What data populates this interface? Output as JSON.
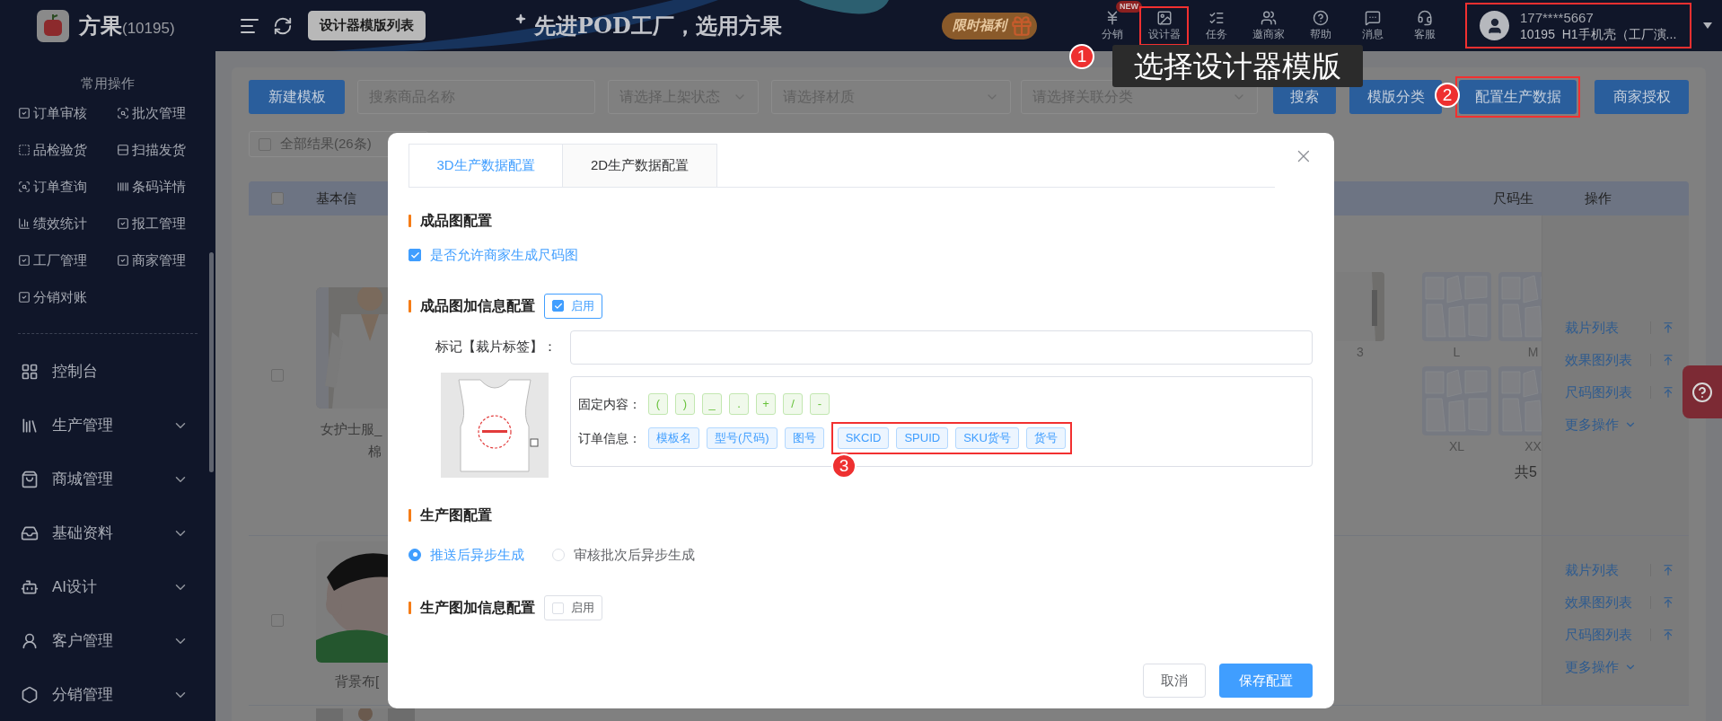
{
  "header": {
    "brand": "方果",
    "brand_id": "(10195)",
    "page_tab": "设计器模版列表",
    "slogan": "先进POD工厂，选用方果",
    "promo": "限时福利",
    "nav": [
      {
        "label": "分销",
        "badge": "NEW",
        "highlighted": false
      },
      {
        "label": "设计器",
        "highlighted": true
      },
      {
        "label": "任务",
        "highlighted": false
      },
      {
        "label": "邀商家",
        "highlighted": false
      },
      {
        "label": "帮助",
        "highlighted": false
      },
      {
        "label": "消息",
        "highlighted": false
      },
      {
        "label": "客服",
        "highlighted": false
      }
    ],
    "user": {
      "phone": "177****5667",
      "account": "10195  H1手机壳（工厂演...",
      "highlighted": true
    }
  },
  "sidebar": {
    "section_title": "常用操作",
    "shortcuts": [
      "订单审核",
      "批次管理",
      "品检验货",
      "扫描发货",
      "订单查询",
      "条码详情",
      "绩效统计",
      "报工管理",
      "工厂管理",
      "商家管理",
      "分销对账"
    ],
    "menu": [
      {
        "label": "控制台",
        "expandable": false
      },
      {
        "label": "生产管理",
        "expandable": true
      },
      {
        "label": "商城管理",
        "expandable": true
      },
      {
        "label": "基础资料",
        "expandable": true
      },
      {
        "label": "AI设计",
        "expandable": true
      },
      {
        "label": "客户管理",
        "expandable": true
      },
      {
        "label": "分销管理",
        "expandable": true
      }
    ]
  },
  "toolbar": {
    "new_button": "新建模板",
    "search": {
      "placeholder": "搜索商品名称"
    },
    "selects": [
      {
        "placeholder": "请选择上架状态"
      },
      {
        "placeholder": "请选择材质"
      },
      {
        "placeholder": "请选择关联分类"
      }
    ],
    "buttons": [
      {
        "label": "搜索",
        "highlighted": false
      },
      {
        "label": "模版分类",
        "highlighted": false
      },
      {
        "label": "配置生产数据",
        "highlighted": true
      },
      {
        "label": "商家授权",
        "highlighted": false
      }
    ]
  },
  "filter": {
    "label": "全部结果(26条)",
    "checked": false
  },
  "table": {
    "header_checked": false,
    "columns": [
      "基本信",
      "尺码生",
      "操作"
    ],
    "rows": [
      {
        "checked": false,
        "caption": [
          "女护士服_",
          "棉"
        ],
        "preview_label": "3",
        "size_charts": [
          "L",
          "M",
          "XL",
          "XX"
        ],
        "size_total": "共5",
        "actions": [
          "裁片列表",
          "效果图列表",
          "尺码图列表"
        ],
        "more": "更多操作"
      },
      {
        "checked": false,
        "caption": [
          "背景布["
        ],
        "actions": [
          "裁片列表",
          "效果图列表",
          "尺码图列表"
        ],
        "more": "更多操作"
      }
    ]
  },
  "modal": {
    "tabs": [
      {
        "label": "3D生产数据配置",
        "selected": true
      },
      {
        "label": "2D生产数据配置",
        "selected": false
      }
    ],
    "finished_image": {
      "title": "成品图配置",
      "allow_size_chart": {
        "label": "是否允许商家生成尺码图",
        "checked": true
      }
    },
    "finished_info": {
      "title": "成品图加信息配置",
      "enable": {
        "label": "启用",
        "checked": true
      },
      "mark_label": "标记【裁片标签】：",
      "fixed_label": "固定内容：",
      "fixed_tags": [
        "(",
        ")",
        "_",
        ".",
        "+",
        "/",
        "-"
      ],
      "order_label": "订单信息：",
      "order_tags": [
        {
          "label": "模板名",
          "highlighted": false
        },
        {
          "label": "型号(尺码)",
          "highlighted": false
        },
        {
          "label": "图号",
          "highlighted": false
        },
        {
          "label": "SKCID",
          "highlighted": true
        },
        {
          "label": "SPUID",
          "highlighted": true
        },
        {
          "label": "SKU货号",
          "highlighted": true
        },
        {
          "label": "货号",
          "highlighted": true
        }
      ]
    },
    "production_image": {
      "title": "生产图配置",
      "options": [
        {
          "label": "推送后异步生成",
          "selected": true
        },
        {
          "label": "审核批次后异步生成",
          "selected": false
        }
      ]
    },
    "production_info": {
      "title": "生产图加信息配置",
      "enable": {
        "label": "启用",
        "checked": false
      }
    },
    "cancel": "取消",
    "save": "保存配置"
  },
  "annotations": {
    "markers": [
      "1",
      "2",
      "3"
    ],
    "tooltip": "选择设计器模版"
  }
}
